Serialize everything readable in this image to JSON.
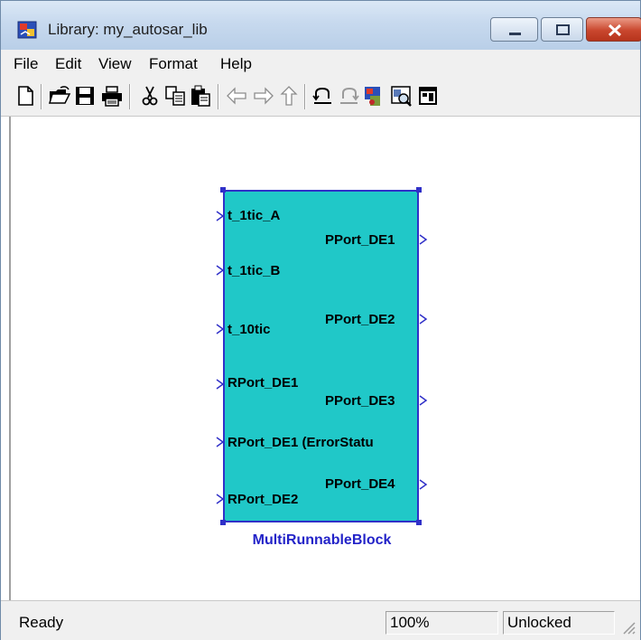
{
  "window": {
    "title": "Library: my_autosar_lib"
  },
  "menu": [
    "File",
    "Edit",
    "View",
    "Format",
    "Help"
  ],
  "toolbar": {
    "icons": [
      "new-file-icon",
      "open-folder-icon",
      "save-icon",
      "print-icon",
      "cut-icon",
      "copy-icon",
      "paste-icon",
      "back-arrow-icon",
      "forward-arrow-icon",
      "up-arrow-icon",
      "undo-icon",
      "redo-icon",
      "library-browser-icon",
      "model-explorer-icon",
      "debugger-icon"
    ]
  },
  "block": {
    "name": "MultiRunnableBlock",
    "color": "#20c8c8",
    "border_color": "#3030c8",
    "inputs": [
      "t_1tic_A",
      "t_1tic_B",
      "t_10tic",
      "RPort_DE1",
      "RPort_DE1 (ErrorStatu",
      "RPort_DE2"
    ],
    "outputs": [
      "PPort_DE1",
      "PPort_DE2",
      "PPort_DE3",
      "PPort_DE4"
    ]
  },
  "status": {
    "text": "Ready",
    "zoom": "100%",
    "lock": "Unlocked"
  }
}
